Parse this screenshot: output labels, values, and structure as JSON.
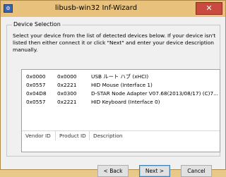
{
  "window": {
    "title": "libusb-win32 Inf-Wizard",
    "icon_name": "app-icon",
    "close_symbol": "✕"
  },
  "group": {
    "label": "Device Selection",
    "instructions": "Select your device from the list of detected devices below. If your device isn't listed then either connect it or click \"Next\" and enter your device description manually."
  },
  "devices": [
    {
      "vendor_id": "0x0000",
      "product_id": "0x0000",
      "description": "USB ルート ハブ (xHCI)"
    },
    {
      "vendor_id": "0x0557",
      "product_id": "0x2221",
      "description": "HID Mouse (Interface 1)"
    },
    {
      "vendor_id": "0x04D8",
      "product_id": "0x0300",
      "description": "D-STAR Node Adapter V07.68(2013/08/17) (C)7..."
    },
    {
      "vendor_id": "0x0557",
      "product_id": "0x2221",
      "description": "HID Keyboard (Interface 0)"
    }
  ],
  "columns": {
    "vendor_id": "Vendor ID",
    "product_id": "Product ID",
    "description": "Description"
  },
  "buttons": {
    "back": "< Back",
    "next": "Next >",
    "cancel": "Cancel"
  }
}
